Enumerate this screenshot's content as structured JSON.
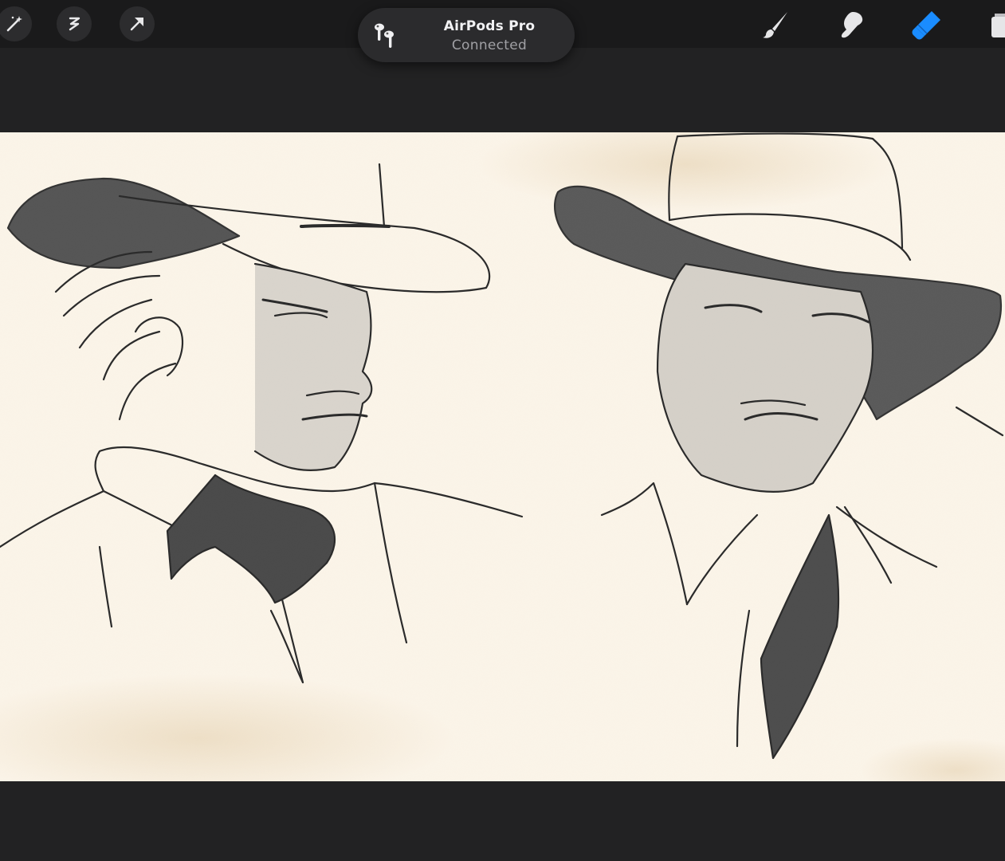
{
  "toolbar": {
    "left_tools": [
      {
        "name": "adjustments-icon"
      },
      {
        "name": "selection-icon"
      },
      {
        "name": "transform-icon"
      }
    ],
    "right_tools": [
      {
        "name": "brush-icon"
      },
      {
        "name": "smudge-icon"
      },
      {
        "name": "eraser-icon",
        "active": true
      },
      {
        "name": "layers-icon"
      }
    ],
    "accent_color": "#1a8cff"
  },
  "notification": {
    "title": "AirPods Pro",
    "subtitle": "Connected",
    "icon": "airpods-icon"
  },
  "canvas": {
    "background_color": "#fbf4e8"
  }
}
